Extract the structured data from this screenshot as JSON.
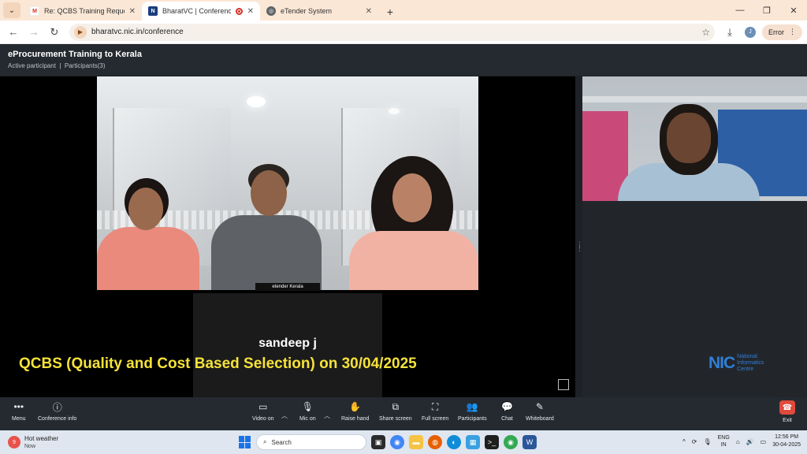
{
  "browser": {
    "tabs": [
      {
        "title": "Re: QCBS Training Request - jo",
        "icon": "gmail-icon",
        "active": false
      },
      {
        "title": "BharatVC | Conference",
        "icon": "nic-icon",
        "active": true
      },
      {
        "title": "eTender System",
        "icon": "globe-icon",
        "active": false
      }
    ],
    "address": "bharatvc.nic.in/conference",
    "profile_initial": "J",
    "error_label": "Error"
  },
  "conference": {
    "title": "eProcurement Training to Kerala",
    "status": "Active participant",
    "participants_label": "Participants(3)",
    "main_video_name_tag": "etender Kerala",
    "speaker_name": "sandeep j",
    "caption": "QCBS (Quality and Cost Based Selection) on 30/04/2025"
  },
  "logo": {
    "mark": "NIC",
    "line1": "National",
    "line2": "Informatics",
    "line3": "Centre"
  },
  "toolbar": {
    "menu": "Menu",
    "conference_info": "Conference info",
    "video_on": "Video on",
    "mic_on": "Mic on",
    "raise_hand": "Raise hand",
    "share_screen": "Share screen",
    "full_screen": "Full screen",
    "participants": "Participants",
    "chat": "Chat",
    "whiteboard": "Whiteboard",
    "exit": "Exit"
  },
  "taskbar": {
    "weather_title": "Hot weather",
    "weather_sub": "Now",
    "weather_badge": "9",
    "search_placeholder": "Search",
    "lang1": "ENG",
    "lang2": "IN",
    "time": "12:56 PM",
    "date": "30-04-2025"
  },
  "colors": {
    "caption": "#f5e23a",
    "exit": "#e04a3c",
    "nic_blue": "#2f7fd8"
  }
}
